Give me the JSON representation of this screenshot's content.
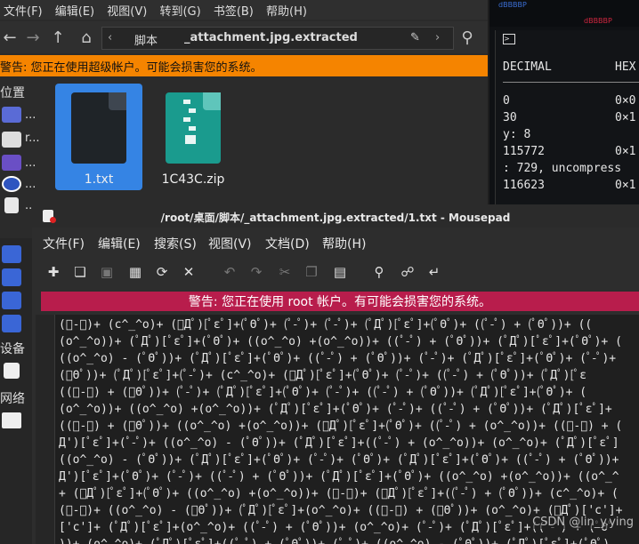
{
  "file_manager": {
    "menu": [
      "文件(F)",
      "编辑(E)",
      "视图(V)",
      "转到(G)",
      "书签(B)",
      "帮助(H)"
    ],
    "breadcrumb": [
      "脚本",
      "_attachment.jpg.extracted"
    ],
    "warning": "警告: 您正在使用超级帐户。可能会损害您的系统。",
    "sidebar": {
      "places_heading": "位置",
      "devices_heading": "设备",
      "network_heading": "网络",
      "items": [
        "...",
        "r...",
        "...",
        "...",
        "..."
      ]
    },
    "files": [
      {
        "name": "1.txt",
        "selected": true
      },
      {
        "name": "1C43C.zip",
        "selected": false
      }
    ]
  },
  "terminal": {
    "header": [
      "DECIMAL",
      "HEX"
    ],
    "lines": [
      "0",
      "0×0",
      "30",
      "0×1",
      "y: 8",
      "115772",
      "0×1",
      ": 729, uncompress",
      "116623",
      "0×1"
    ],
    "banner": "dBBBBP"
  },
  "mousepad": {
    "title": "/root/桌面/脚本/_attachment.jpg.extracted/1.txt - Mousepad",
    "menu": [
      "文件(F)",
      "编辑(E)",
      "搜索(S)",
      "视图(V)",
      "文档(D)",
      "帮助(H)"
    ],
    "warning": "警告: 您正在使用 root 帐户。有可能会损害您的系统。",
    "code_lines": [
      "(ﾟ-ﾟ)+ (c^_^o)+ (ﾟДﾟ)[ﾟεﾟ]+(ﾟΘﾟ)+ (ﾟ-ﾟ)+ (ﾟ-ﾟ)+ (ﾟДﾟ)[ﾟεﾟ]+(ﾟΘﾟ)+ ((ﾟ-ﾟ) + (ﾟΘﾟ))+ ((",
      "(o^_^o))+ (ﾟДﾟ)[ﾟεﾟ]+(ﾟΘﾟ)+ ((o^_^o) +(o^_^o))+ ((ﾟ-ﾟ) + (ﾟΘﾟ))+ (ﾟДﾟ)[ﾟεﾟ]+(ﾟΘﾟ)+ (",
      "((o^_^o) - (ﾟΘﾟ))+ (ﾟДﾟ)[ﾟεﾟ]+(ﾟΘﾟ)+ ((ﾟ-ﾟ) + (ﾟΘﾟ))+ (ﾟ-ﾟ)+ (ﾟДﾟ)[ﾟεﾟ]+(ﾟΘﾟ)+ (ﾟ-ﾟ)+",
      "(ﾟΘﾟ))+ (ﾟДﾟ)[ﾟεﾟ]+(ﾟ-ﾟ)+ (c^_^o)+ (ﾟДﾟ)[ﾟεﾟ]+(ﾟΘﾟ)+ (ﾟ-ﾟ)+ ((ﾟ-ﾟ) + (ﾟΘﾟ))+ (ﾟДﾟ)[ﾟε",
      "((ﾟ-ﾟ) + (ﾟΘﾟ))+ (ﾟ-ﾟ)+ (ﾟДﾟ)[ﾟεﾟ]+(ﾟΘﾟ)+ (ﾟ-ﾟ)+ ((ﾟ-ﾟ) + (ﾟΘﾟ))+ (ﾟДﾟ)[ﾟεﾟ]+(ﾟΘﾟ)+ (",
      "(o^_^o))+ ((o^_^o) +(o^_^o))+ (ﾟДﾟ)[ﾟεﾟ]+(ﾟΘﾟ)+ (ﾟ-ﾟ)+ ((ﾟ-ﾟ) + (ﾟΘﾟ))+ (ﾟДﾟ)[ﾟεﾟ]+",
      "((ﾟ-ﾟ) + (ﾟΘﾟ))+ ((o^_^o) +(o^_^o))+ (ﾟДﾟ)[ﾟεﾟ]+(ﾟΘﾟ)+ ((ﾟ-ﾟ) + (o^_^o))+ ((ﾟ-ﾟ) + (",
      "Д')[ﾟεﾟ]+(ﾟ-ﾟ)+ ((o^_^o) - (ﾟΘﾟ))+ (ﾟДﾟ)[ﾟεﾟ]+((ﾟ-ﾟ) + (o^_^o))+ (o^_^o)+ (ﾟДﾟ)[ﾟεﾟ]",
      "((o^_^o) - (ﾟΘﾟ))+ (ﾟДﾟ)[ﾟεﾟ]+(ﾟΘﾟ)+ (ﾟ-ﾟ)+ (ﾟΘﾟ)+ (ﾟДﾟ)[ﾟεﾟ]+(ﾟΘﾟ)+ ((ﾟ-ﾟ) + (ﾟΘﾟ))+",
      "Д')[ﾟεﾟ]+(ﾟΘﾟ)+ (ﾟ-ﾟ)+ ((ﾟ-ﾟ) + (ﾟΘﾟ))+ (ﾟДﾟ)[ﾟεﾟ]+(ﾟΘﾟ)+ ((o^_^o) +(o^_^o))+ ((o^_^",
      "+ (ﾟДﾟ)[ﾟεﾟ]+(ﾟΘﾟ)+ ((o^_^o) +(o^_^o))+ (ﾟ-ﾟ)+ (ﾟДﾟ)[ﾟεﾟ]+((ﾟ-ﾟ) + (ﾟΘﾟ))+ (c^_^o)+ (",
      "(ﾟ-ﾟ)+ ((o^_^o) - (ﾟΘﾟ))+ (ﾟДﾟ)[ﾟεﾟ]+(o^_^o)+ ((ﾟ-ﾟ) + (ﾟΘﾟ))+ (o^_^o)+ (ﾟДﾟ)['c']+",
      "['c']+ (ﾟДﾟ)[ﾟεﾟ]+(o^_^o)+ ((ﾟ-ﾟ) + (ﾟΘﾟ))+ (o^_^o)+ (ﾟ-ﾟ)+ (ﾟДﾟ)[ﾟεﾟ]+((ﾟ-ﾟ) + (ﾟΘﾟ",
      "))+ (o^_^o)+ (ﾟДﾟ)[ﾟεﾟ]+((ﾟ-ﾟ) + (ﾟΘﾟ))+ (ﾟ-ﾟ)+ ((o^_^o) - (ﾟΘﾟ))+ (ﾟДﾟ)[ﾟεﾟ]+(ﾟΘﾟ)"
    ],
    "watermark": "CSDN @lin_y.ying"
  }
}
